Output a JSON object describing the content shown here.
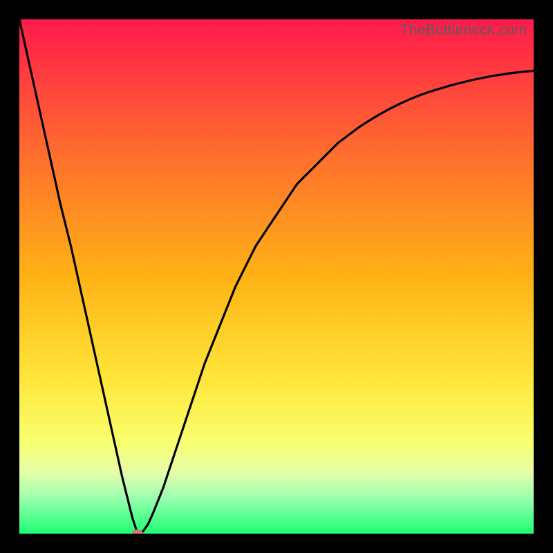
{
  "watermark": "TheBottleneck.com",
  "colors": {
    "frame": "#000000",
    "grad_top": "#ff1a4b",
    "grad_25": "#ff6a2f",
    "grad_50": "#ffb215",
    "grad_70": "#ffe63a",
    "grad_82": "#f8ff6e",
    "grad_88": "#e6ffa8",
    "grad_93": "#9cffb0",
    "grad_bottom": "#1dff73",
    "curve": "#000000",
    "marker": "#c97f78"
  },
  "chart_data": {
    "type": "line",
    "title": "",
    "xlabel": "",
    "ylabel": "",
    "xlim": [
      0,
      100
    ],
    "ylim": [
      0,
      100
    ],
    "x": [
      0,
      2,
      4,
      6,
      8,
      10,
      12,
      14,
      16,
      18,
      20,
      22,
      23,
      24,
      25,
      26,
      28,
      30,
      32,
      34,
      36,
      38,
      40,
      42,
      44,
      46,
      48,
      50,
      52,
      54,
      56,
      58,
      60,
      62,
      64,
      66,
      68,
      70,
      72,
      74,
      76,
      78,
      80,
      82,
      84,
      86,
      88,
      90,
      92,
      94,
      96,
      98,
      100
    ],
    "values": [
      100,
      91,
      82,
      73,
      64,
      56,
      47,
      38,
      29,
      20,
      11,
      3,
      0,
      0.4,
      1.8,
      4,
      9,
      15,
      21,
      27,
      33,
      38,
      43,
      48,
      52,
      56,
      59,
      62,
      65,
      68,
      70,
      72,
      74,
      76,
      77.5,
      79,
      80.3,
      81.5,
      82.6,
      83.6,
      84.5,
      85.3,
      86,
      86.6,
      87.2,
      87.7,
      88.2,
      88.6,
      89,
      89.3,
      89.6,
      89.8,
      90
    ],
    "marker": {
      "x": 23,
      "y": 0
    }
  }
}
